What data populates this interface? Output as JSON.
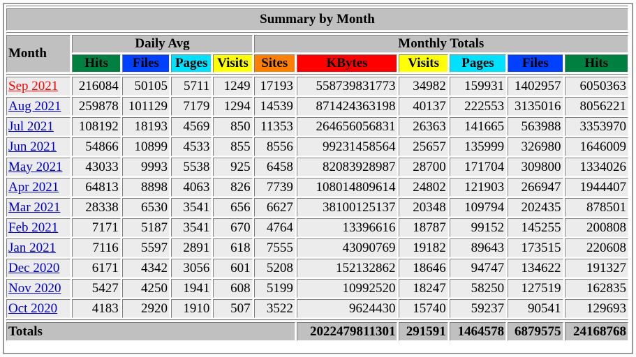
{
  "title": "Summary by Month",
  "headers": {
    "month": "Month",
    "daily_avg": "Daily Avg",
    "monthly_totals": "Monthly Totals",
    "daily_cols": [
      "Hits",
      "Files",
      "Pages",
      "Visits"
    ],
    "monthly_cols": [
      "Sites",
      "KBytes",
      "Visits",
      "Pages",
      "Files",
      "Hits"
    ]
  },
  "colors": {
    "hits": "#008040",
    "files": "#0040ff",
    "pages": "#00e0ff",
    "visits": "#ffff00",
    "sites": "#ff8000",
    "kbytes": "#ff0000"
  },
  "rows": [
    {
      "month": "Sep 2021",
      "d_hits": "216084",
      "d_files": "50105",
      "d_pages": "5711",
      "d_visits": "1249",
      "sites": "17193",
      "kbytes": "558739831773",
      "visits": "34982",
      "pages": "159931",
      "files": "1402957",
      "hits": "6050363"
    },
    {
      "month": "Aug 2021",
      "d_hits": "259878",
      "d_files": "101129",
      "d_pages": "7179",
      "d_visits": "1294",
      "sites": "14539",
      "kbytes": "871424363198",
      "visits": "40137",
      "pages": "222553",
      "files": "3135016",
      "hits": "8056221"
    },
    {
      "month": "Jul 2021",
      "d_hits": "108192",
      "d_files": "18193",
      "d_pages": "4569",
      "d_visits": "850",
      "sites": "11353",
      "kbytes": "264656056831",
      "visits": "26363",
      "pages": "141665",
      "files": "563988",
      "hits": "3353970"
    },
    {
      "month": "Jun 2021",
      "d_hits": "54866",
      "d_files": "10899",
      "d_pages": "4533",
      "d_visits": "855",
      "sites": "8556",
      "kbytes": "99231458564",
      "visits": "25657",
      "pages": "135999",
      "files": "326980",
      "hits": "1646009"
    },
    {
      "month": "May 2021",
      "d_hits": "43033",
      "d_files": "9993",
      "d_pages": "5538",
      "d_visits": "925",
      "sites": "6458",
      "kbytes": "82083928987",
      "visits": "28700",
      "pages": "171704",
      "files": "309800",
      "hits": "1334026"
    },
    {
      "month": "Apr 2021",
      "d_hits": "64813",
      "d_files": "8898",
      "d_pages": "4063",
      "d_visits": "826",
      "sites": "7739",
      "kbytes": "108014809614",
      "visits": "24802",
      "pages": "121903",
      "files": "266947",
      "hits": "1944407"
    },
    {
      "month": "Mar 2021",
      "d_hits": "28338",
      "d_files": "6530",
      "d_pages": "3541",
      "d_visits": "656",
      "sites": "6627",
      "kbytes": "38100125137",
      "visits": "20348",
      "pages": "109794",
      "files": "202435",
      "hits": "878501"
    },
    {
      "month": "Feb 2021",
      "d_hits": "7171",
      "d_files": "5187",
      "d_pages": "3541",
      "d_visits": "670",
      "sites": "4764",
      "kbytes": "13396616",
      "visits": "18787",
      "pages": "99152",
      "files": "145255",
      "hits": "200808"
    },
    {
      "month": "Jan 2021",
      "d_hits": "7116",
      "d_files": "5597",
      "d_pages": "2891",
      "d_visits": "618",
      "sites": "7555",
      "kbytes": "43090769",
      "visits": "19182",
      "pages": "89643",
      "files": "173515",
      "hits": "220608"
    },
    {
      "month": "Dec 2020",
      "d_hits": "6171",
      "d_files": "4342",
      "d_pages": "3056",
      "d_visits": "601",
      "sites": "5208",
      "kbytes": "152132862",
      "visits": "18646",
      "pages": "94747",
      "files": "134622",
      "hits": "191327"
    },
    {
      "month": "Nov 2020",
      "d_hits": "5427",
      "d_files": "4250",
      "d_pages": "1941",
      "d_visits": "608",
      "sites": "5199",
      "kbytes": "10992520",
      "visits": "18247",
      "pages": "58250",
      "files": "127519",
      "hits": "162835"
    },
    {
      "month": "Oct 2020",
      "d_hits": "4183",
      "d_files": "2920",
      "d_pages": "1910",
      "d_visits": "507",
      "sites": "3522",
      "kbytes": "9624430",
      "visits": "15740",
      "pages": "59237",
      "files": "90541",
      "hits": "129693"
    }
  ],
  "active_month": "Sep 2021",
  "totals": {
    "label": "Totals",
    "kbytes": "2022479811301",
    "visits": "291591",
    "pages": "1464578",
    "files": "6879575",
    "hits": "24168768"
  }
}
